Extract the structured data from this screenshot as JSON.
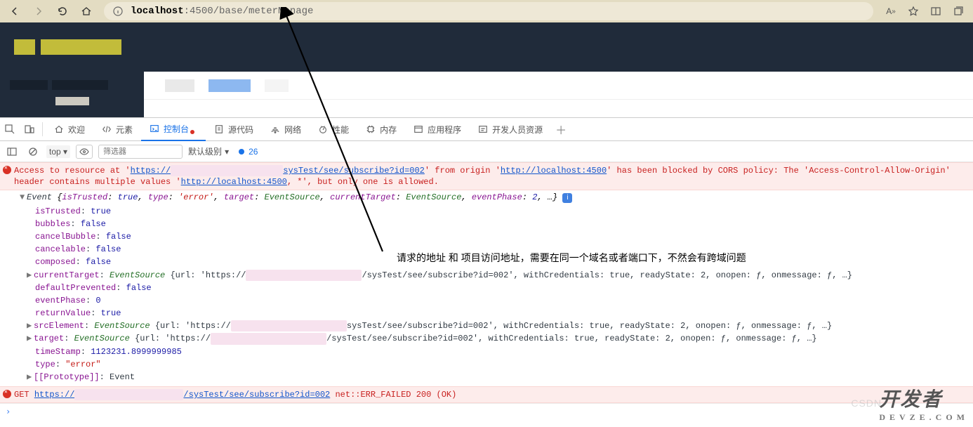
{
  "browser": {
    "url_host": "localhost",
    "url_rest": ":4500/base/meterManage"
  },
  "devtools_tabs": {
    "welcome": "欢迎",
    "elements": "元素",
    "console": "控制台",
    "sources": "源代码",
    "network": "网络",
    "performance": "性能",
    "memory": "内存",
    "application": "应用程序",
    "devres": "开发人员资源"
  },
  "filter": {
    "top": "top",
    "placeholder": "筛选器",
    "level": "默认级别",
    "issues": "26"
  },
  "cors": {
    "pre": "Access to resource at '",
    "url1": "https://",
    "url1_tail": "sysTest/see/subscribe?id=002",
    "mid1": "' from origin '",
    "origin": "http://localhost:4500",
    "mid2": "' has been blocked by CORS policy: The 'Access-Control-Allow-Origin' header contains multiple values '",
    "url2": "http://localhost:4500",
    "tail": ", *', but only one is allowed."
  },
  "event": {
    "summary_pre": "Event ",
    "summary_body": "{isTrusted: true, type: 'error', target: EventSource, currentTarget: EventSource, eventPhase: 2, …}",
    "lines": {
      "isTrusted": "true",
      "bubbles": "false",
      "cancelBubble": "false",
      "cancelable": "false",
      "composed": "false"
    },
    "currentTarget": {
      "label": "currentTarget",
      "cls": "EventSource",
      "url_pre": "{url: 'https://",
      "url_tail": "/sysTest/see/subscribe?id=002'",
      "rest": ", withCredentials: true, readyState: 2, onopen: ƒ, onmessage: ƒ, …}"
    },
    "defaultPrevented": "false",
    "eventPhase": "0",
    "returnValue": "true",
    "srcElement": {
      "label": "srcElement",
      "cls": "EventSource",
      "url_pre": "{url: 'https://",
      "url_tail": "sysTest/see/subscribe?id=002'",
      "rest": ", withCredentials: true, readyState: 2, onopen: ƒ, onmessage: ƒ, …}"
    },
    "target": {
      "label": "target",
      "cls": "EventSource",
      "url_pre": "{url: 'https://",
      "url_tail": "/sysTest/see/subscribe?id=002'",
      "rest": ", withCredentials: true, readyState: 2, onopen: ƒ, onmessage: ƒ, …}"
    },
    "timeStamp": "1123231.8999999985",
    "type_val": "\"error\"",
    "proto": "[[Prototype]]",
    "proto_val": "Event"
  },
  "net_fail": {
    "method": "GET",
    "url_pre": "https://",
    "url_tail": "/sysTest/see/subscribe?id=002",
    "status": "net::ERR_FAILED 200 (OK)"
  },
  "annotation": "请求的地址 和 项目访问地址，需要在同一个域名或者端口下，不然会有跨域问题",
  "watermark": {
    "big": "开发者",
    "small": "DEVZE.COM"
  },
  "csdn": "CSDN"
}
